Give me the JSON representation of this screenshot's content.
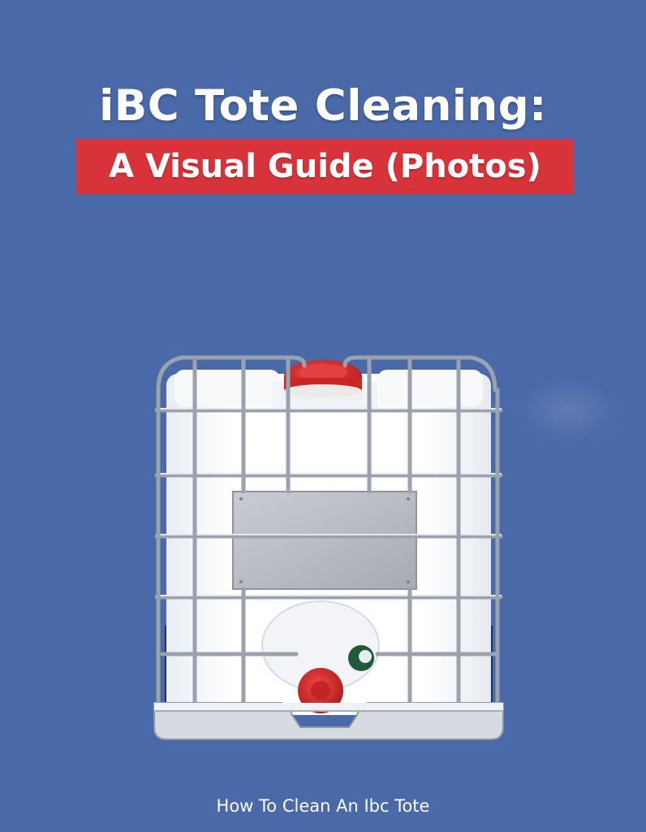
{
  "title": {
    "line1": "iBC Tote Cleaning:",
    "line2": "A Visual Guide (Photos)"
  },
  "footer": {
    "text": "How To Clean An Ibc Tote"
  },
  "colors": {
    "background": "#4a69a8",
    "banner": "#d8333a",
    "text": "#ffffff",
    "cap": "#d92a2a",
    "valve_handle": "#1f5a3a"
  },
  "illustration": {
    "subject": "ibc-tote-icon"
  }
}
